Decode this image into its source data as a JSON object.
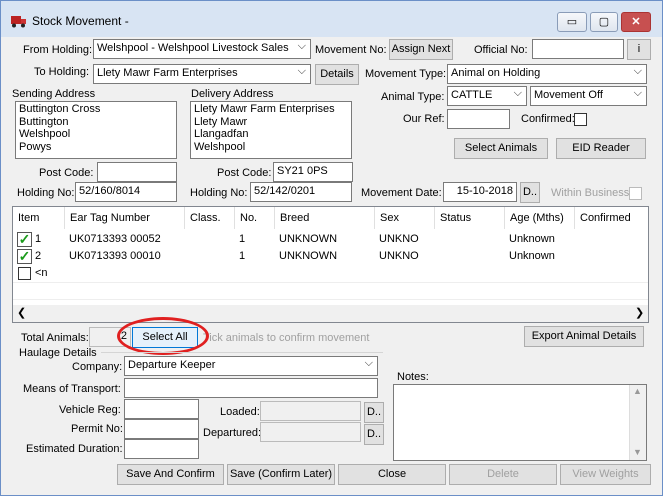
{
  "window": {
    "title": "Stock Movement -",
    "minimize": "▭",
    "maximize": "▢",
    "close": "✕"
  },
  "from_holding": {
    "label": "From Holding:",
    "value": "Welshpool - Welshpool Livestock Sales"
  },
  "to_holding": {
    "label": "To Holding:",
    "value": "Llety Mawr Farm Enterprises",
    "details_button": "Details"
  },
  "movement_no": {
    "label": "Movement No:",
    "button": "Assign Next"
  },
  "official_no": {
    "label": "Official No:",
    "value": "",
    "info_button": "i"
  },
  "movement_type": {
    "label": "Movement Type:",
    "value": "Animal on Holding"
  },
  "animal_type": {
    "label": "Animal Type:",
    "value": "CATTLE",
    "movement_value": "Movement Off"
  },
  "our_ref": {
    "label": "Our Ref:",
    "value": ""
  },
  "confirmed": {
    "label": "Confirmed:"
  },
  "sending_address": {
    "label": "Sending Address",
    "lines": [
      "Buttington Cross",
      "Buttington",
      "Welshpool",
      "Powys"
    ],
    "postcode_label": "Post Code:",
    "postcode": "",
    "holding_label": "Holding No:",
    "holding": "52/160/8014"
  },
  "delivery_address": {
    "label": "Delivery Address",
    "lines": [
      "Llety Mawr Farm Enterprises",
      "Llety Mawr",
      "Llangadfan",
      "Welshpool"
    ],
    "postcode_label": "Post Code:",
    "postcode": "SY21 0PS",
    "holding_label": "Holding No:",
    "holding": "52/142/0201"
  },
  "select_animals_button": "Select Animals",
  "eid_reader_button": "EID Reader",
  "movement_date": {
    "label": "Movement Date:",
    "value": "15-10-2018",
    "button": "D.."
  },
  "within_business": {
    "label": "Within Business"
  },
  "grid": {
    "columns": [
      "Item",
      "Ear Tag Number",
      "Class.",
      "No.",
      "Breed",
      "Sex",
      "Status",
      "Age (Mths)",
      "Confirmed"
    ],
    "rows": [
      {
        "item": "1",
        "tag": "UK0713393 00052",
        "class": "",
        "no": "1",
        "breed": "UNKNOWN",
        "sex": "UNKNO",
        "status": "",
        "age": "Unknown",
        "confirmed": ""
      },
      {
        "item": "2",
        "tag": "UK0713393 00010",
        "class": "",
        "no": "1",
        "breed": "UNKNOWN",
        "sex": "UNKNO",
        "status": "",
        "age": "Unknown",
        "confirmed": ""
      }
    ],
    "new_row": "<n"
  },
  "total_animals": {
    "label": "Total Animals:",
    "value": "2"
  },
  "select_all_button": "Select All",
  "confirm_hint": "Tick animals to confirm movement",
  "export_button": "Export Animal Details",
  "haulage": {
    "label": "Haulage Details",
    "company_label": "Company:",
    "company": "Departure Keeper",
    "transport_label": "Means of Transport:",
    "transport": "",
    "vehicle_label": "Vehicle Reg:",
    "vehicle": "",
    "permit_label": "Permit No:",
    "permit": "",
    "duration_label": "Estimated Duration:",
    "duration": "",
    "loaded_label": "Loaded:",
    "loaded": "",
    "departured_label": "Departured:",
    "departured": "",
    "date_button": "D.."
  },
  "notes": {
    "label": "Notes:",
    "value": ""
  },
  "footer": {
    "save_confirm": "Save And Confirm",
    "save_later": "Save (Confirm Later)",
    "close": "Close",
    "delete": "Delete",
    "view_weights": "View Weights"
  }
}
